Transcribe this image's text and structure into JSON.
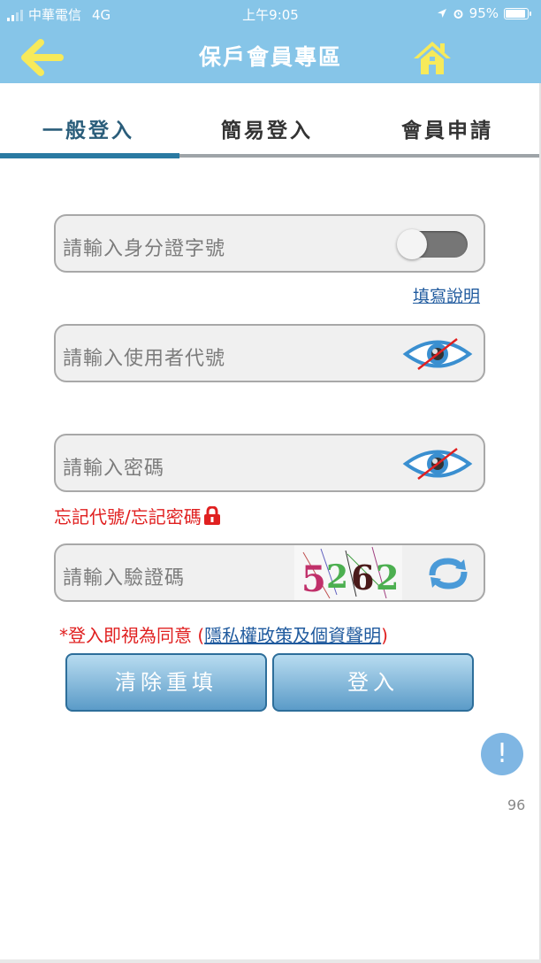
{
  "status_bar": {
    "carrier": "中華電信",
    "network": "4G",
    "time": "上午9:05",
    "battery": "95%"
  },
  "header": {
    "title": "保戶會員專區",
    "back_icon": "arrow-left-icon",
    "home_icon": "home-icon"
  },
  "tabs": [
    {
      "label": "一般登入",
      "active": true
    },
    {
      "label": "簡易登入",
      "active": false
    },
    {
      "label": "會員申請",
      "active": false
    }
  ],
  "form": {
    "id_placeholder": "請輸入身分證字號",
    "id_toggle_on": false,
    "help_link": "填寫說明",
    "user_placeholder": "請輸入使用者代號",
    "password_placeholder": "請輸入密碼",
    "forgot_link": "忘記代號/忘記密碼",
    "captcha_placeholder": "請輸入驗證碼",
    "captcha_text": "5262"
  },
  "agreement": {
    "prefix": "*登入即視為同意 (",
    "link": "隱私權政策及個資聲明",
    "suffix": ")"
  },
  "buttons": {
    "clear": "清除重填",
    "login": "登入"
  },
  "alert_icon": "!",
  "counter": "96",
  "colors": {
    "header_bg": "#86c5e8",
    "accent": "#2a7aa2",
    "error_red": "#e02020",
    "link_blue": "#1f5a9e",
    "arrow_yellow": "#f7ea5a"
  }
}
